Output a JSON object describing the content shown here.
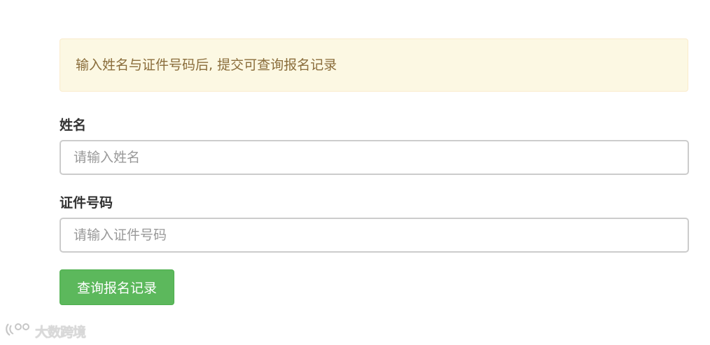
{
  "notice": {
    "text": "输入姓名与证件号码后, 提交可查询报名记录"
  },
  "form": {
    "name_label": "姓名",
    "name_placeholder": "请输入姓名",
    "name_value": "",
    "id_label": "证件号码",
    "id_placeholder": "请输入证件号码",
    "id_value": "",
    "submit_label": "查询报名记录"
  },
  "colors": {
    "notice_bg": "#fcf8e3",
    "notice_text": "#8a6d3b",
    "submit_bg": "#5cb85c"
  },
  "watermark": {
    "icon": "watermark-logo-icon",
    "text": "大数跨境"
  }
}
